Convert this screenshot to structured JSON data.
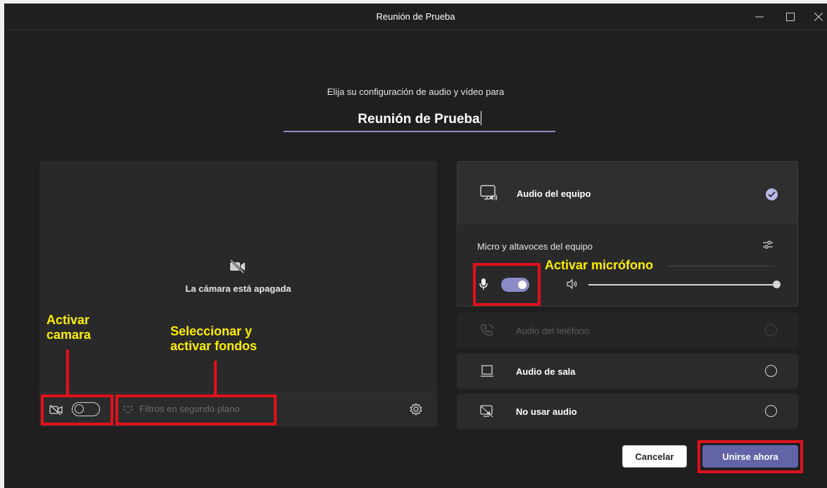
{
  "window": {
    "title": "Reunión de Prueba",
    "controls": [
      "minimize",
      "maximize",
      "close"
    ]
  },
  "prejoin": {
    "subtitle": "Elija su configuración de audio y vídeo para",
    "meeting_name": "Reunión de Prueba"
  },
  "video": {
    "camera_off_text": "La cámara está apagada",
    "camera_toggle": "off",
    "filters_label": "Filtros en segundo plano"
  },
  "audio_options": {
    "computer_audio": {
      "label": "Audio del equipo",
      "selected": true
    },
    "devices_label": "Micro y altavoces del equipo",
    "mic_toggle": "on",
    "volume_level": 1.0,
    "phone_audio": {
      "label": "Audio del teléfono",
      "enabled": false
    },
    "room_audio": {
      "label": "Audio de sala"
    },
    "no_audio": {
      "label": "No usar audio"
    }
  },
  "buttons": {
    "cancel": "Cancelar",
    "join": "Unirse ahora"
  },
  "annotations": {
    "camera": "Activar camara",
    "camera_line1": "Activar",
    "camera_line2": "camara",
    "backgrounds_line1": "Seleccionar y",
    "backgrounds_line2": "activar fondos",
    "microphone": "Activar micrófono"
  },
  "colors": {
    "background": "#1f1f1f",
    "panel": "#292929",
    "accent": "#6264a7",
    "toggle_on": "#8b8cc7",
    "highlight": "#e0111b",
    "annotation": "#ffee00"
  }
}
